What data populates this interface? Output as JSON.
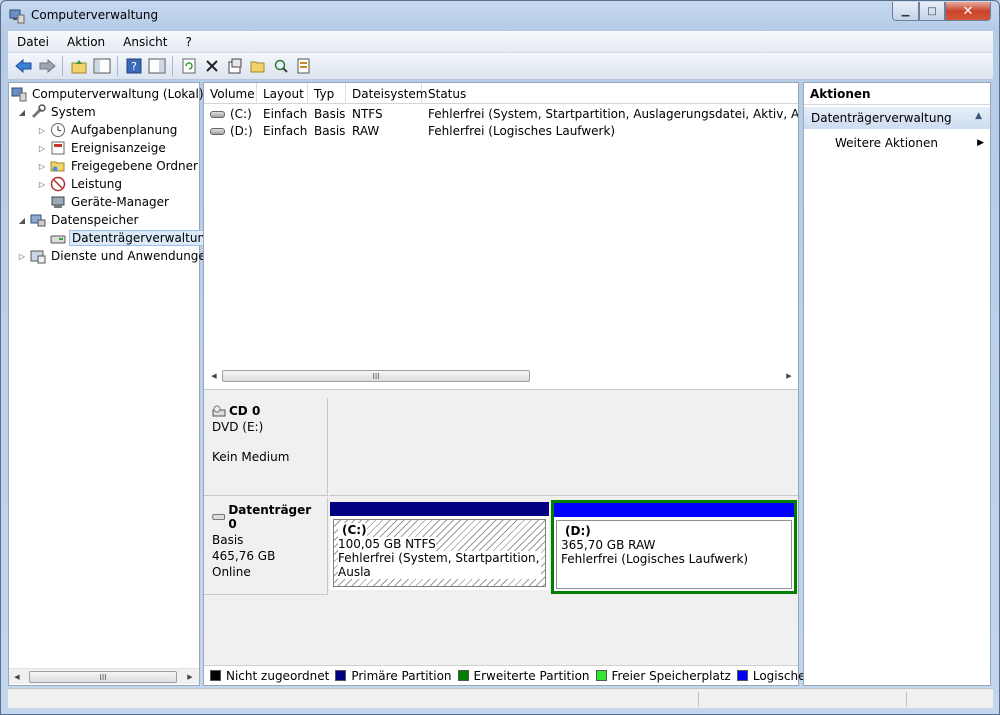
{
  "window": {
    "title": "Computerverwaltung"
  },
  "menu": [
    "Datei",
    "Aktion",
    "Ansicht",
    "?"
  ],
  "toolbar": [
    "back-icon",
    "forward-icon",
    "up-folder-icon",
    "show-tree-icon",
    "help-icon",
    "show-action-pane-icon",
    "refresh-icon",
    "delete-icon",
    "properties-icon",
    "open-icon",
    "search-icon",
    "export-icon"
  ],
  "tree": {
    "root": "Computerverwaltung (Lokal)",
    "system": "System",
    "aufgabenplanung": "Aufgabenplanung",
    "ereignisanzeige": "Ereignisanzeige",
    "freigegebene": "Freigegebene Ordner",
    "leistung": "Leistung",
    "geraete": "Geräte-Manager",
    "datenspeicher": "Datenspeicher",
    "datentraeger": "Datenträgerverwaltung",
    "dienste": "Dienste und Anwendungen"
  },
  "volumes": {
    "headers": [
      "Volume",
      "Layout",
      "Typ",
      "Dateisystem",
      "Status"
    ],
    "rows": [
      {
        "volume": "(C:)",
        "layout": "Einfach",
        "typ": "Basis",
        "fs": "NTFS",
        "status": "Fehlerfrei (System, Startpartition, Auslagerungsdatei, Aktiv, Absturzabb"
      },
      {
        "volume": "(D:)",
        "layout": "Einfach",
        "typ": "Basis",
        "fs": "RAW",
        "status": "Fehlerfrei (Logisches Laufwerk)"
      }
    ]
  },
  "disks": {
    "cd0": {
      "title": "CD 0",
      "line1": "DVD (E:)",
      "line2": "Kein Medium"
    },
    "disk0": {
      "title": "Datenträger 0",
      "line1": "Basis",
      "line2": "465,76 GB",
      "line3": "Online"
    },
    "partC": {
      "name": "(C:)",
      "size": "100,05 GB NTFS",
      "status": "Fehlerfrei (System, Startpartition, Ausla"
    },
    "partD": {
      "name": "(D:)",
      "size": "365,70 GB RAW",
      "status": "Fehlerfrei (Logisches Laufwerk)"
    }
  },
  "legend": [
    {
      "label": "Nicht zugeordnet",
      "color": "#000000"
    },
    {
      "label": "Primäre Partition",
      "color": "#000080"
    },
    {
      "label": "Erweiterte Partition",
      "color": "#008000"
    },
    {
      "label": "Freier Speicherplatz",
      "color": "#33e633"
    },
    {
      "label": "Logisches Laufwerk",
      "color": "#0000ff"
    }
  ],
  "actions": {
    "heading": "Aktionen",
    "section": "Datenträgerverwaltung",
    "more": "Weitere Aktionen"
  },
  "scroll": {
    "thumb_glyph": "III"
  },
  "colors": {
    "primary_bar": "#000080",
    "logical_bar": "#0000ff",
    "extended_border": "#008000"
  }
}
